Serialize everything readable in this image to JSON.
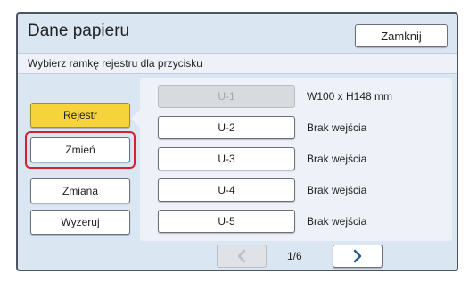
{
  "dialog": {
    "title": "Dane papieru",
    "close_label": "Zamknij",
    "instruction": "Wybierz ramkę rejestru dla przycisku"
  },
  "left_buttons": [
    {
      "label": "Rejestr",
      "state": "active"
    },
    {
      "label": "Zmień",
      "state": "highlighted"
    },
    {
      "label": "Zmiana",
      "state": "normal"
    },
    {
      "label": "Wyzeruj",
      "state": "normal"
    }
  ],
  "registers": [
    {
      "label": "U-1",
      "value": "W100 x H148 mm",
      "disabled": true
    },
    {
      "label": "U-2",
      "value": "Brak wejścia",
      "disabled": false
    },
    {
      "label": "U-3",
      "value": "Brak wejścia",
      "disabled": false
    },
    {
      "label": "U-4",
      "value": "Brak wejścia",
      "disabled": false
    },
    {
      "label": "U-5",
      "value": "Brak wejścia",
      "disabled": false
    }
  ],
  "pager": {
    "page_text": "1/6",
    "prev_icon": "chevron-left-icon",
    "next_icon": "chevron-right-icon"
  },
  "colors": {
    "background": "#dbe6f3",
    "active_button": "#f6d33a",
    "highlight_border": "#d6212c",
    "next_arrow": "#1f5f97",
    "disabled_arrow": "#b9bfc8"
  }
}
